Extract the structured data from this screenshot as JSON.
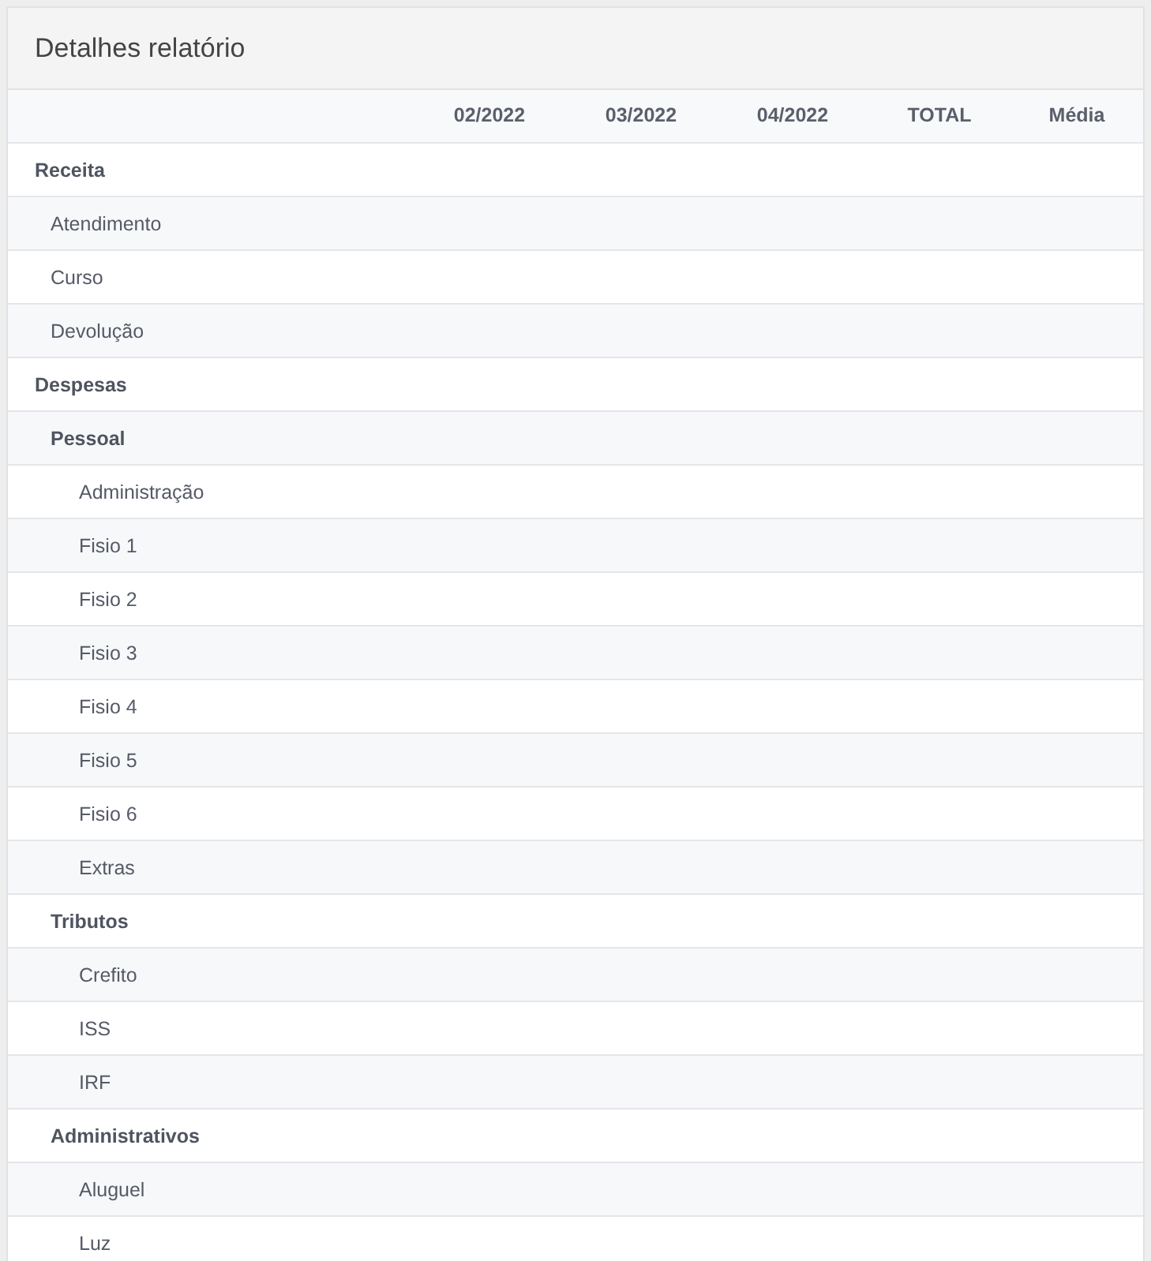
{
  "card": {
    "title": "Detalhes relatório"
  },
  "table": {
    "columns": [
      "02/2022",
      "03/2022",
      "04/2022",
      "TOTAL",
      "Média"
    ],
    "rows": [
      {
        "label": "Receita",
        "children": [
          {
            "label": "Atendimento"
          },
          {
            "label": "Curso"
          },
          {
            "label": "Devolução"
          }
        ]
      },
      {
        "label": "Despesas",
        "children": [
          {
            "label": "Pessoal",
            "children": [
              {
                "label": "Administração"
              },
              {
                "label": "Fisio 1"
              },
              {
                "label": "Fisio 2"
              },
              {
                "label": "Fisio 3"
              },
              {
                "label": "Fisio 4"
              },
              {
                "label": "Fisio 5"
              },
              {
                "label": "Fisio 6"
              },
              {
                "label": "Extras"
              }
            ]
          },
          {
            "label": "Tributos",
            "children": [
              {
                "label": "Crefito"
              },
              {
                "label": "ISS"
              },
              {
                "label": "IRF"
              }
            ]
          },
          {
            "label": "Administrativos",
            "children": [
              {
                "label": "Aluguel"
              },
              {
                "label": "Luz"
              }
            ]
          }
        ]
      }
    ]
  }
}
